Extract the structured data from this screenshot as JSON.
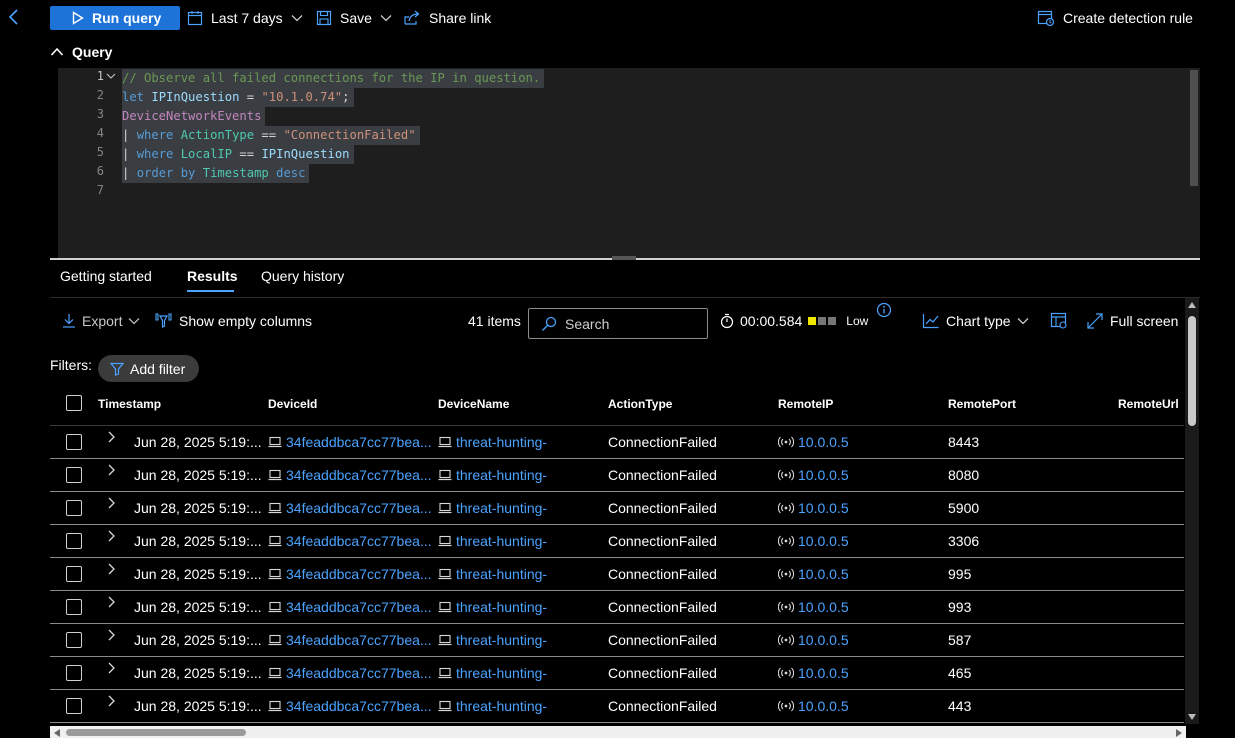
{
  "toolbar": {
    "run_query": "Run query",
    "time_range": "Last 7 days",
    "save": "Save",
    "share_link": "Share link",
    "create_detection_rule": "Create detection rule"
  },
  "query": {
    "header": "Query",
    "line_numbers": [
      "1",
      "2",
      "3",
      "4",
      "5",
      "6",
      "7"
    ],
    "lines": [
      {
        "tokens": [
          {
            "t": "// Observe all failed connections for the IP in question.",
            "c": "comment"
          }
        ]
      },
      {
        "tokens": [
          {
            "t": "let ",
            "c": "kw"
          },
          {
            "t": "IPInQuestion",
            "c": "var"
          },
          {
            "t": " = ",
            "c": "op"
          },
          {
            "t": "\"10.1.0.74\"",
            "c": "str"
          },
          {
            "t": ";",
            "c": "op"
          }
        ]
      },
      {
        "tokens": [
          {
            "t": "DeviceNetworkEvents",
            "c": "table"
          }
        ]
      },
      {
        "tokens": [
          {
            "t": "| ",
            "c": "op"
          },
          {
            "t": "where ",
            "c": "kw"
          },
          {
            "t": "ActionType",
            "c": "func"
          },
          {
            "t": " == ",
            "c": "op"
          },
          {
            "t": "\"ConnectionFailed\"",
            "c": "str"
          }
        ]
      },
      {
        "tokens": [
          {
            "t": "| ",
            "c": "op"
          },
          {
            "t": "where ",
            "c": "kw"
          },
          {
            "t": "LocalIP",
            "c": "func"
          },
          {
            "t": " == ",
            "c": "op"
          },
          {
            "t": "IPInQuestion",
            "c": "var"
          }
        ]
      },
      {
        "tokens": [
          {
            "t": "| ",
            "c": "op"
          },
          {
            "t": "order by ",
            "c": "kw"
          },
          {
            "t": "Timestamp",
            "c": "func"
          },
          {
            "t": " desc",
            "c": "kw"
          }
        ]
      }
    ]
  },
  "tabs": [
    {
      "label": "Getting started",
      "active": false
    },
    {
      "label": "Results",
      "active": true
    },
    {
      "label": "Query history",
      "active": false
    }
  ],
  "results_toolbar": {
    "export": "Export",
    "show_empty_columns": "Show empty columns",
    "items_count": "41 items",
    "search_placeholder": "Search",
    "elapsed": "00:00.584",
    "quality": "Low",
    "chart_type": "Chart type",
    "full_screen": "Full screen"
  },
  "filters": {
    "label": "Filters:",
    "add_filter": "Add filter"
  },
  "table": {
    "columns": [
      "Timestamp",
      "DeviceId",
      "DeviceName",
      "ActionType",
      "RemoteIP",
      "RemotePort",
      "RemoteUrl"
    ],
    "rows": [
      {
        "timestamp": "Jun 28, 2025 5:19:...",
        "device_id": "34feaddbca7cc77bea...",
        "device_name": "threat-hunting-",
        "action_type": "ConnectionFailed",
        "remote_ip": "10.0.0.5",
        "remote_port": "8443"
      },
      {
        "timestamp": "Jun 28, 2025 5:19:...",
        "device_id": "34feaddbca7cc77bea...",
        "device_name": "threat-hunting-",
        "action_type": "ConnectionFailed",
        "remote_ip": "10.0.0.5",
        "remote_port": "8080"
      },
      {
        "timestamp": "Jun 28, 2025 5:19:...",
        "device_id": "34feaddbca7cc77bea...",
        "device_name": "threat-hunting-",
        "action_type": "ConnectionFailed",
        "remote_ip": "10.0.0.5",
        "remote_port": "5900"
      },
      {
        "timestamp": "Jun 28, 2025 5:19:...",
        "device_id": "34feaddbca7cc77bea...",
        "device_name": "threat-hunting-",
        "action_type": "ConnectionFailed",
        "remote_ip": "10.0.0.5",
        "remote_port": "3306"
      },
      {
        "timestamp": "Jun 28, 2025 5:19:...",
        "device_id": "34feaddbca7cc77bea...",
        "device_name": "threat-hunting-",
        "action_type": "ConnectionFailed",
        "remote_ip": "10.0.0.5",
        "remote_port": "995"
      },
      {
        "timestamp": "Jun 28, 2025 5:19:...",
        "device_id": "34feaddbca7cc77bea...",
        "device_name": "threat-hunting-",
        "action_type": "ConnectionFailed",
        "remote_ip": "10.0.0.5",
        "remote_port": "993"
      },
      {
        "timestamp": "Jun 28, 2025 5:19:...",
        "device_id": "34feaddbca7cc77bea...",
        "device_name": "threat-hunting-",
        "action_type": "ConnectionFailed",
        "remote_ip": "10.0.0.5",
        "remote_port": "587"
      },
      {
        "timestamp": "Jun 28, 2025 5:19:...",
        "device_id": "34feaddbca7cc77bea...",
        "device_name": "threat-hunting-",
        "action_type": "ConnectionFailed",
        "remote_ip": "10.0.0.5",
        "remote_port": "465"
      },
      {
        "timestamp": "Jun 28, 2025 5:19:...",
        "device_id": "34feaddbca7cc77bea...",
        "device_name": "threat-hunting-",
        "action_type": "ConnectionFailed",
        "remote_ip": "10.0.0.5",
        "remote_port": "443"
      }
    ]
  },
  "colors": {
    "accent": "#1e73d8",
    "link": "#4aa3ff",
    "quality_on": "#f2e600"
  }
}
